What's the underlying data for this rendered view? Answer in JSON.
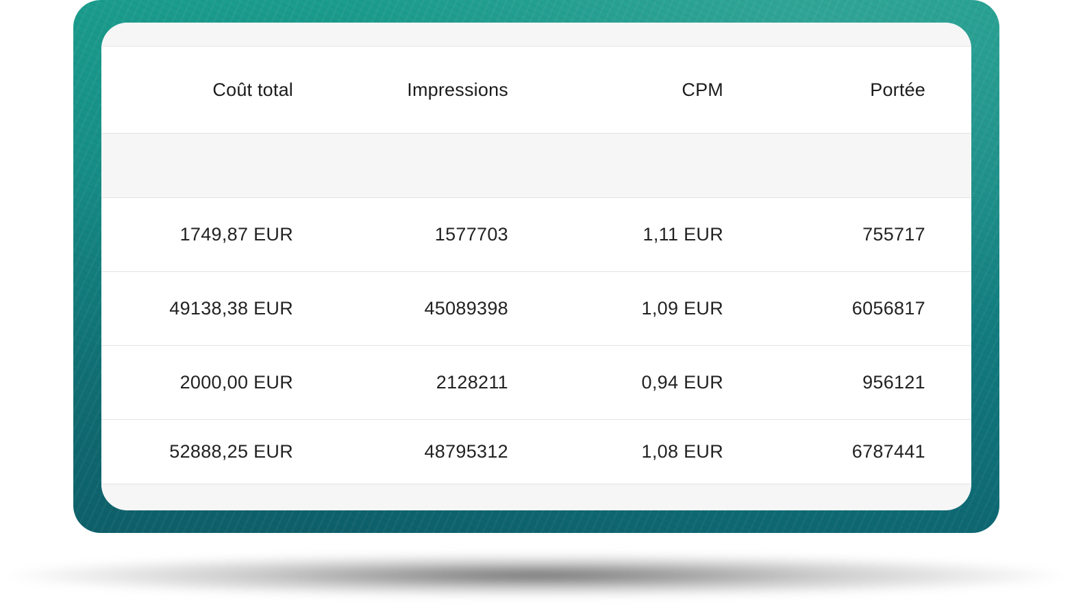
{
  "table": {
    "columns": [
      "Coût total",
      "Impressions",
      "CPM",
      "Portée"
    ],
    "rows": [
      [
        "1749,87 EUR",
        "1577703",
        "1,11 EUR",
        "755717"
      ],
      [
        "49138,38 EUR",
        "45089398",
        "1,09 EUR",
        "6056817"
      ],
      [
        "2000,00 EUR",
        "2128211",
        "0,94 EUR",
        "956121"
      ],
      [
        "52888,25 EUR",
        "48795312",
        "1,08 EUR",
        "6787441"
      ]
    ]
  },
  "colors": {
    "frame_top": "#1b9c8c",
    "frame_bottom": "#0e6772",
    "card_background": "#ffffff",
    "stripe_background": "#f6f6f6",
    "text": "#222222"
  }
}
